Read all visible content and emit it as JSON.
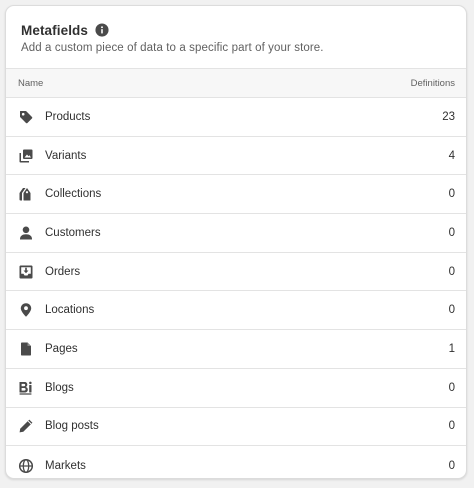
{
  "card": {
    "title": "Metafields",
    "subtitle": "Add a custom piece of data to a specific part of your store."
  },
  "table": {
    "col_name": "Name",
    "col_definitions": "Definitions",
    "rows": [
      {
        "icon": "product-tag-icon",
        "label": "Products",
        "count": "23"
      },
      {
        "icon": "variants-icon",
        "label": "Variants",
        "count": "4"
      },
      {
        "icon": "collections-icon",
        "label": "Collections",
        "count": "0"
      },
      {
        "icon": "customer-person-icon",
        "label": "Customers",
        "count": "0"
      },
      {
        "icon": "orders-inbox-icon",
        "label": "Orders",
        "count": "0"
      },
      {
        "icon": "location-pin-icon",
        "label": "Locations",
        "count": "0"
      },
      {
        "icon": "page-document-icon",
        "label": "Pages",
        "count": "1"
      },
      {
        "icon": "blog-icon",
        "label": "Blogs",
        "count": "0"
      },
      {
        "icon": "pencil-icon",
        "label": "Blog posts",
        "count": "0"
      },
      {
        "icon": "globe-icon",
        "label": "Markets",
        "count": "0"
      }
    ]
  },
  "colors": {
    "background": "#f1f1f1",
    "card": "#ffffff",
    "icon": "#4a4a4a",
    "text": "#303030",
    "muted": "#616161"
  }
}
